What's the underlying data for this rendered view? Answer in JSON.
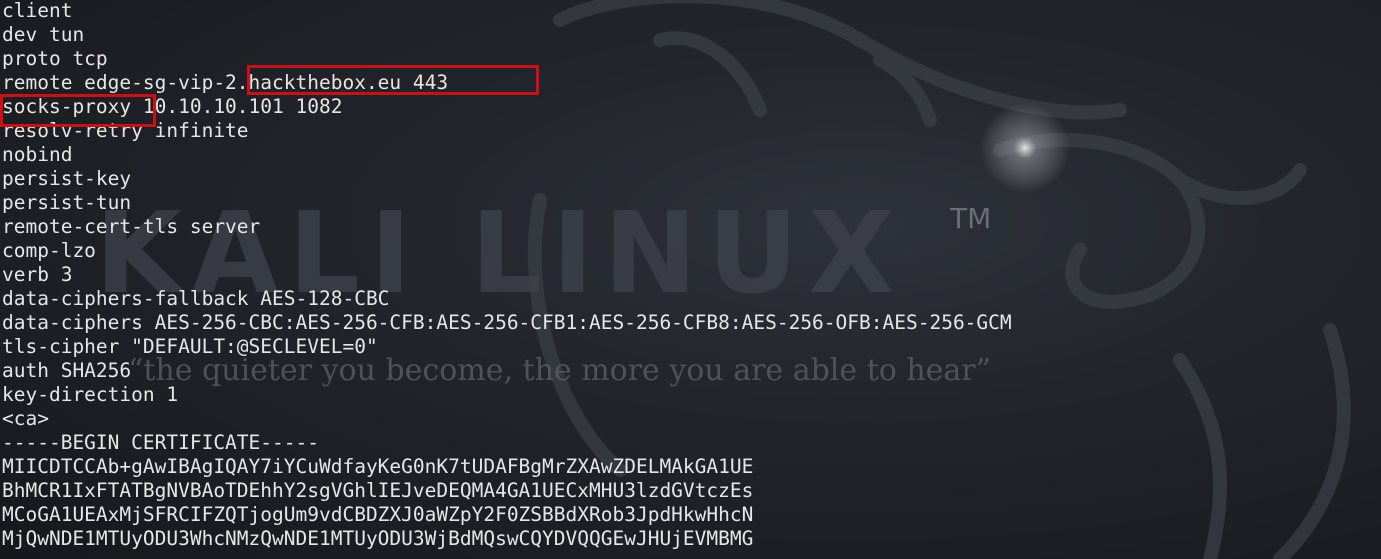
{
  "wallpaper": {
    "brand_text": "KALI LINUX",
    "trademark": "TM",
    "slogan": "“the quieter you become, the more you are able to hear”"
  },
  "terminal": {
    "lines": [
      "client",
      "dev tun",
      "proto tcp",
      "remote edge-sg-vip-2.hackthebox.eu 443",
      "socks-proxy 10.10.10.101 1082",
      "resolv-retry infinite",
      "nobind",
      "persist-key",
      "persist-tun",
      "remote-cert-tls server",
      "comp-lzo",
      "verb 3",
      "data-ciphers-fallback AES-128-CBC",
      "data-ciphers AES-256-CBC:AES-256-CFB:AES-256-CFB1:AES-256-CFB8:AES-256-OFB:AES-256-GCM",
      "tls-cipher \"DEFAULT:@SECLEVEL=0\"",
      "auth SHA256",
      "key-direction 1",
      "<ca>",
      "-----BEGIN CERTIFICATE-----",
      "MIICDTCCAb+gAwIBAgIQAY7iYCuWdfayKeG0nK7tUDAFBgMrZXAwZDELMAkGA1UE",
      "BhMCR1IxFTATBgNVBAoTDEhhY2sgVGhlIEJveDEQMA4GA1UECxMHU3lzdGVtczEs",
      "MCoGA1UEAxMjSFRCIFZQTjogUm9vdCBDZXJ0aWZpY2F0ZSBBdXRob3JpdHkwHhcN",
      "MjQwNDE1MTUyODU3WhcNMzQwNDE1MTUyODU3WjBdMQswCQYDVQQGEwJHUjEVMBMG"
    ],
    "highlight_color": "#d00f14"
  }
}
